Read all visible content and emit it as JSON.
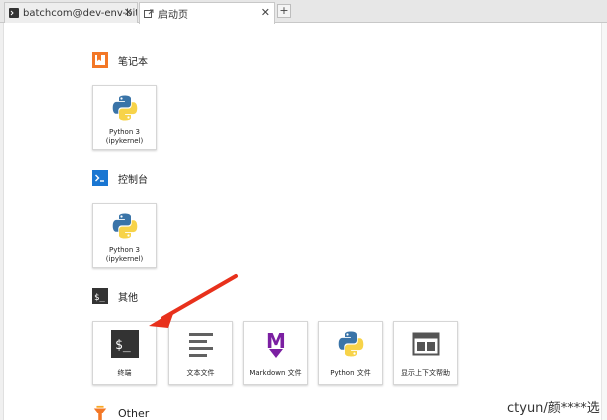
{
  "tabs": [
    {
      "label": "batchcom@dev-env-bitnet",
      "close": "✕"
    },
    {
      "label": "启动页",
      "close": "✕"
    }
  ],
  "add_tab": "+",
  "sections": {
    "notebook": {
      "title": "笔记本",
      "cards": [
        {
          "line1": "Python 3",
          "line2": "(ipykernel)"
        }
      ]
    },
    "console": {
      "title": "控制台",
      "cards": [
        {
          "line1": "Python 3",
          "line2": "(ipykernel)"
        }
      ]
    },
    "other": {
      "title": "其他",
      "cards": [
        {
          "label": "终端"
        },
        {
          "label": "文本文件"
        },
        {
          "label": "Markdown 文件"
        },
        {
          "label": "Python 文件"
        },
        {
          "label": "显示上下文帮助"
        }
      ]
    },
    "other_en": {
      "title": "Other"
    }
  },
  "icons": {
    "terminal_tab": "terminal-icon",
    "launcher_tab": "launcher-icon",
    "notebook": "notebook-icon",
    "console": "console-icon",
    "other": "terminal-icon",
    "other_en": "extension-icon"
  },
  "colors": {
    "notebook_orange": "#f37726",
    "console_blue": "#1976d2",
    "markdown_purple": "#7b1fa2",
    "python_blue": "#3a74a8",
    "python_yellow": "#f7d349",
    "arrow_red": "#e8311c"
  },
  "watermark": "ctyun/颜****选"
}
